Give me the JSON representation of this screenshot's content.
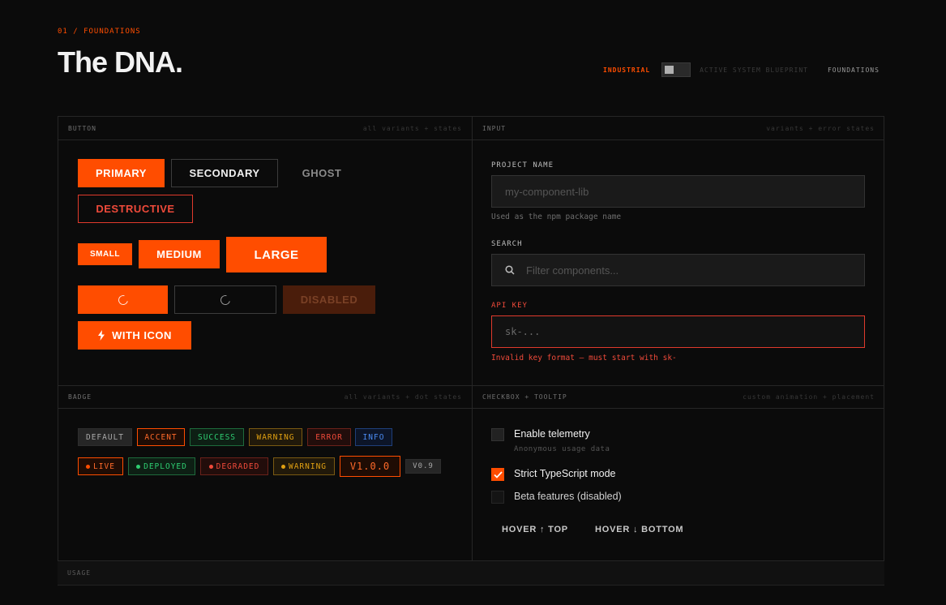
{
  "header": {
    "eyebrow": "01 / FOUNDATIONS",
    "title": "The DNA.",
    "nav": {
      "industrial": "INDUSTRIAL",
      "blueprint": "ACTIVE SYSTEM BLUEPRINT",
      "foundations": "FOUNDATIONS"
    }
  },
  "panels": {
    "button": {
      "title": "BUTTON",
      "subtitle": "all variants + states"
    },
    "input": {
      "title": "INPUT",
      "subtitle": "variants + error states"
    },
    "badge": {
      "title": "BADGE",
      "subtitle": "all variants + dot states"
    },
    "checkbox": {
      "title": "CHECKBOX + TOOLTIP",
      "subtitle": "custom animation + placement"
    },
    "usage": {
      "title": "USAGE"
    }
  },
  "buttons": {
    "primary": "PRIMARY",
    "secondary": "SECONDARY",
    "ghost": "GHOST",
    "destructive": "DESTRUCTIVE",
    "small": "SMALL",
    "medium": "MEDIUM",
    "large": "LARGE",
    "disabled": "DISABLED",
    "with_icon": "WITH ICON"
  },
  "inputs": {
    "project": {
      "label": "PROJECT NAME",
      "placeholder": "my-component-lib",
      "hint": "Used as the npm package name"
    },
    "search": {
      "label": "SEARCH",
      "placeholder": "Filter components..."
    },
    "api": {
      "label": "API KEY",
      "placeholder": "sk-...",
      "error": "Invalid key format — must start with sk-"
    }
  },
  "badges": {
    "row1": [
      "DEFAULT",
      "ACCENT",
      "SUCCESS",
      "WARNING",
      "ERROR",
      "INFO"
    ],
    "row2": [
      "LIVE",
      "DEPLOYED",
      "DEGRADED",
      "WARNING",
      "V1.0.0",
      "V0.9"
    ]
  },
  "checkboxes": {
    "telemetry": {
      "label": "Enable telemetry",
      "desc": "Anonymous usage data",
      "checked": false
    },
    "strict": {
      "label": "Strict TypeScript mode",
      "checked": true
    },
    "beta": {
      "label": "Beta features (disabled)",
      "checked": false
    }
  },
  "tooltips": {
    "top": "HOVER ↑ TOP",
    "bottom": "HOVER ↓ BOTTOM"
  },
  "colors": {
    "accent": "#ff4d00",
    "error": "#ef4a3a",
    "success": "#2ecc71",
    "warning": "#e0a012",
    "info": "#3b82f6"
  }
}
